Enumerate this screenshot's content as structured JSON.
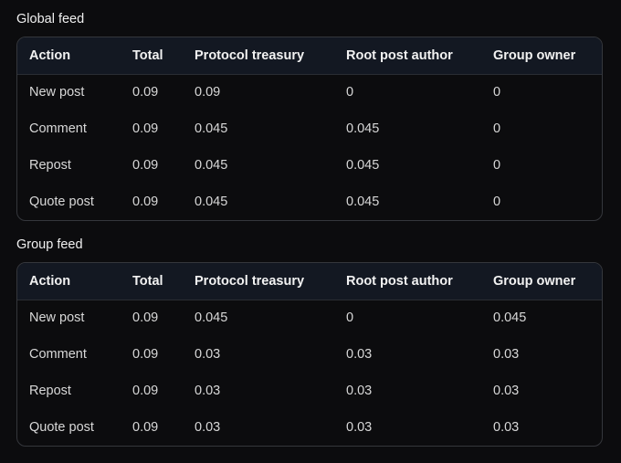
{
  "global_feed": {
    "title": "Global feed",
    "headers": [
      "Action",
      "Total",
      "Protocol treasury",
      "Root post author",
      "Group owner"
    ],
    "rows": [
      [
        "New post",
        "0.09",
        "0.09",
        "0",
        "0"
      ],
      [
        "Comment",
        "0.09",
        "0.045",
        "0.045",
        "0"
      ],
      [
        "Repost",
        "0.09",
        "0.045",
        "0.045",
        "0"
      ],
      [
        "Quote post",
        "0.09",
        "0.045",
        "0.045",
        "0"
      ]
    ]
  },
  "group_feed": {
    "title": "Group feed",
    "headers": [
      "Action",
      "Total",
      "Protocol treasury",
      "Root post author",
      "Group owner"
    ],
    "rows": [
      [
        "New post",
        "0.09",
        "0.045",
        "0",
        "0.045"
      ],
      [
        "Comment",
        "0.09",
        "0.03",
        "0.03",
        "0.03"
      ],
      [
        "Repost",
        "0.09",
        "0.03",
        "0.03",
        "0.03"
      ],
      [
        "Quote post",
        "0.09",
        "0.03",
        "0.03",
        "0.03"
      ]
    ]
  }
}
